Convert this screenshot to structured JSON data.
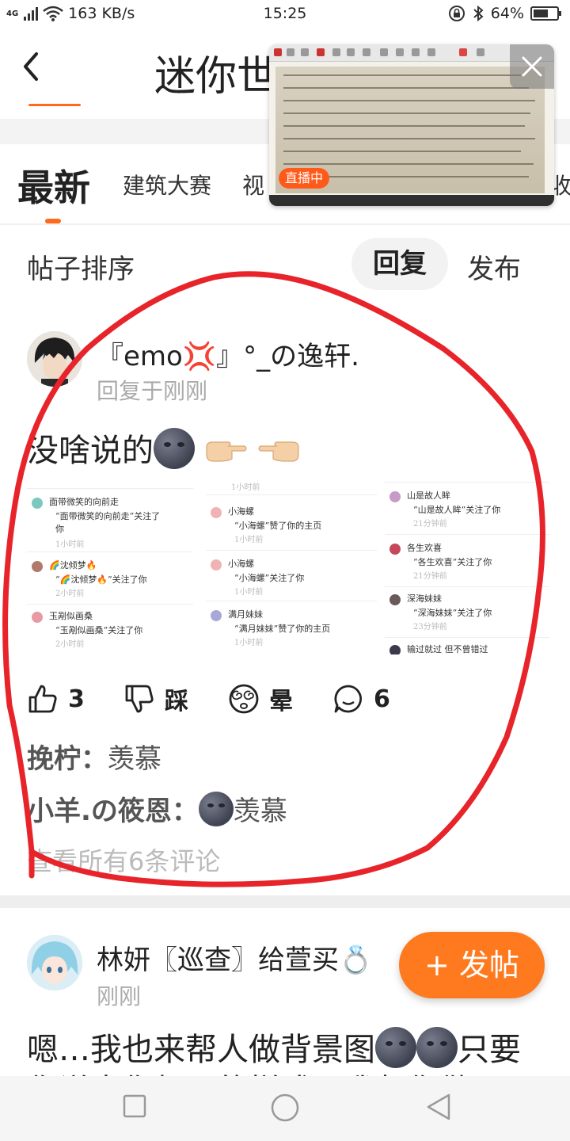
{
  "status_bar": {
    "network": "4G",
    "speed": "163 KB/s",
    "time": "15:25",
    "battery": "64%",
    "battery_level": 0.64
  },
  "header": {
    "title": "迷你世",
    "back_icon": "chevron-left-icon"
  },
  "live_pip": {
    "badge": "直播中",
    "close_icon": "close-icon"
  },
  "tabs": [
    {
      "label": "最新",
      "active": true
    },
    {
      "label": "建筑大赛",
      "active": false
    },
    {
      "label": "视",
      "active": false
    },
    {
      "label": "收",
      "active": false
    }
  ],
  "sort": {
    "label": "帖子排序",
    "options": [
      "回复",
      "发布"
    ],
    "selected": "回复"
  },
  "post1": {
    "user": "『emo💢』°_の逸轩.",
    "time": "回复于刚刚",
    "content": "没啥说的",
    "notices": [
      {
        "name": "面带微笑的向前走",
        "msg": "“面带微笑的向前走”关注了",
        "msg2": "你",
        "ago": "1小时前"
      },
      {
        "name": "🌈沈倾梦🔥",
        "msg": "“🌈沈倾梦🔥”关注了你",
        "ago": "2小时前"
      },
      {
        "name": "玉剐似画桑",
        "msg": "“玉剐似画桑”关注了你",
        "ago": "2小时前"
      },
      {
        "name": "小海螺",
        "msg": "“小海螺”赞了你的主页",
        "ago": "1小时前",
        "top": "1小时前"
      },
      {
        "name": "小海螺",
        "msg": "“小海螺”关注了你",
        "ago": "1小时前"
      },
      {
        "name": "满月妹妹",
        "msg": "“满月妹妹”赞了你的主页",
        "ago": "1小时前"
      },
      {
        "name": "山是故人眸",
        "msg": "“山是故人眸”关注了你",
        "ago": "21分钟前"
      },
      {
        "name": "各生欢喜",
        "msg": "“各生欢喜”关注了你",
        "ago": "21分钟前"
      },
      {
        "name": "深海妹妹",
        "msg": "“深海妹妹”关注了你",
        "ago": "23分钟前"
      },
      {
        "name": "输过就过 但不曾错过",
        "msg": "",
        "ago": ""
      }
    ],
    "actions": {
      "like_count": "3",
      "dislike_label": "踩",
      "dizzy_label": "晕",
      "comment_count": "6"
    },
    "comments": [
      {
        "who": "挽柠：",
        "text": "羡慕",
        "has_emoji": false
      },
      {
        "who": "小羊.の筱恩：",
        "text": "羡慕",
        "has_emoji": true
      }
    ],
    "view_all": "查看所有6条评论"
  },
  "post2": {
    "user": "林妍〖巡查〗给萱买💍",
    "time": "刚刚",
    "content_start": "嗯…我也来帮人做背景图",
    "content_end": "只要",
    "content_line2": "你说出你想要的样式，我帮你做"
  },
  "fab": {
    "label": "+ 发帖"
  },
  "colors": {
    "accent": "#ff7a1f",
    "annotation": "#e8242b",
    "muted": "#aaaaaa"
  }
}
